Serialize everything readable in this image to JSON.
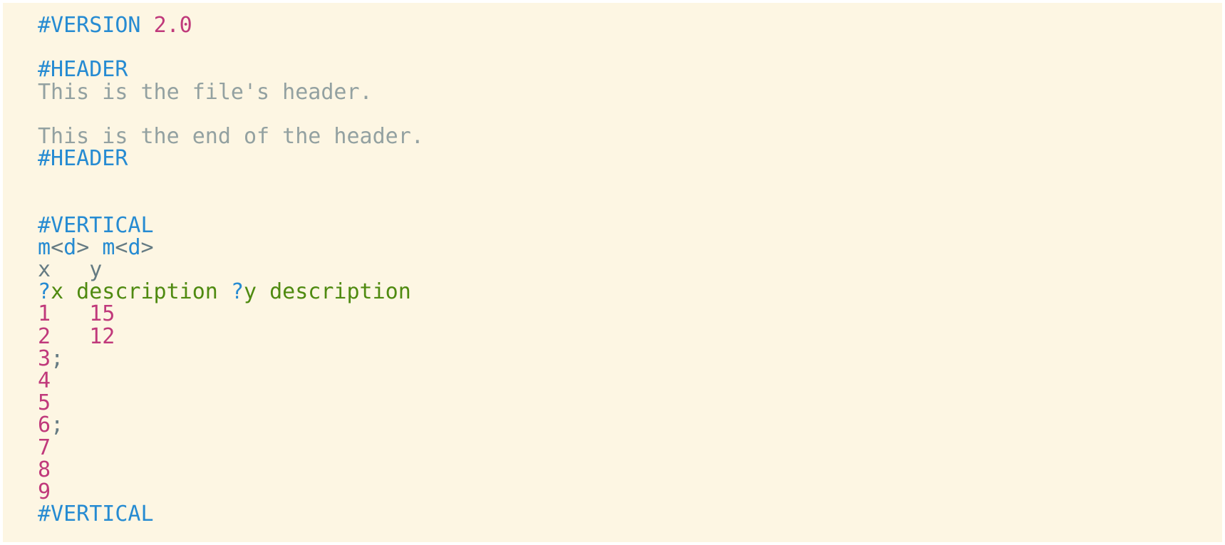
{
  "colors": {
    "background": "#fdf6e3",
    "keyword": "#268bd2",
    "number": "#c0397b",
    "comment": "#93a1a1",
    "text": "#657b83",
    "description": "#4f8a10"
  },
  "lines": [
    [
      {
        "t": "kw",
        "v": "#VERSION"
      },
      {
        "t": "txt",
        "v": " "
      },
      {
        "t": "num",
        "v": "2.0"
      }
    ],
    [],
    [
      {
        "t": "kw",
        "v": "#HEADER"
      }
    ],
    [
      {
        "t": "cmt",
        "v": "This is the file's header."
      }
    ],
    [],
    [
      {
        "t": "cmt",
        "v": "This is the end of the header."
      }
    ],
    [
      {
        "t": "kw",
        "v": "#HEADER"
      }
    ],
    [],
    [],
    [
      {
        "t": "kw",
        "v": "#VERTICAL"
      }
    ],
    [
      {
        "t": "kw",
        "v": "m"
      },
      {
        "t": "txt",
        "v": "<"
      },
      {
        "t": "kw",
        "v": "d"
      },
      {
        "t": "txt",
        "v": ">"
      },
      {
        "t": "txt",
        "v": " "
      },
      {
        "t": "kw",
        "v": "m"
      },
      {
        "t": "txt",
        "v": "<"
      },
      {
        "t": "kw",
        "v": "d"
      },
      {
        "t": "txt",
        "v": ">"
      }
    ],
    [
      {
        "t": "txt",
        "v": "x   y"
      }
    ],
    [
      {
        "t": "kw",
        "v": "?"
      },
      {
        "t": "des",
        "v": "x description "
      },
      {
        "t": "kw",
        "v": "?"
      },
      {
        "t": "des",
        "v": "y description"
      }
    ],
    [
      {
        "t": "num",
        "v": "1"
      },
      {
        "t": "txt",
        "v": "   "
      },
      {
        "t": "num",
        "v": "15"
      }
    ],
    [
      {
        "t": "num",
        "v": "2"
      },
      {
        "t": "txt",
        "v": "   "
      },
      {
        "t": "num",
        "v": "12"
      }
    ],
    [
      {
        "t": "num",
        "v": "3"
      },
      {
        "t": "txt",
        "v": ";"
      }
    ],
    [
      {
        "t": "num",
        "v": "4"
      }
    ],
    [
      {
        "t": "num",
        "v": "5"
      }
    ],
    [
      {
        "t": "num",
        "v": "6"
      },
      {
        "t": "txt",
        "v": ";"
      }
    ],
    [
      {
        "t": "num",
        "v": "7"
      }
    ],
    [
      {
        "t": "num",
        "v": "8"
      }
    ],
    [
      {
        "t": "num",
        "v": "9"
      }
    ],
    [
      {
        "t": "kw",
        "v": "#VERTICAL"
      }
    ]
  ]
}
